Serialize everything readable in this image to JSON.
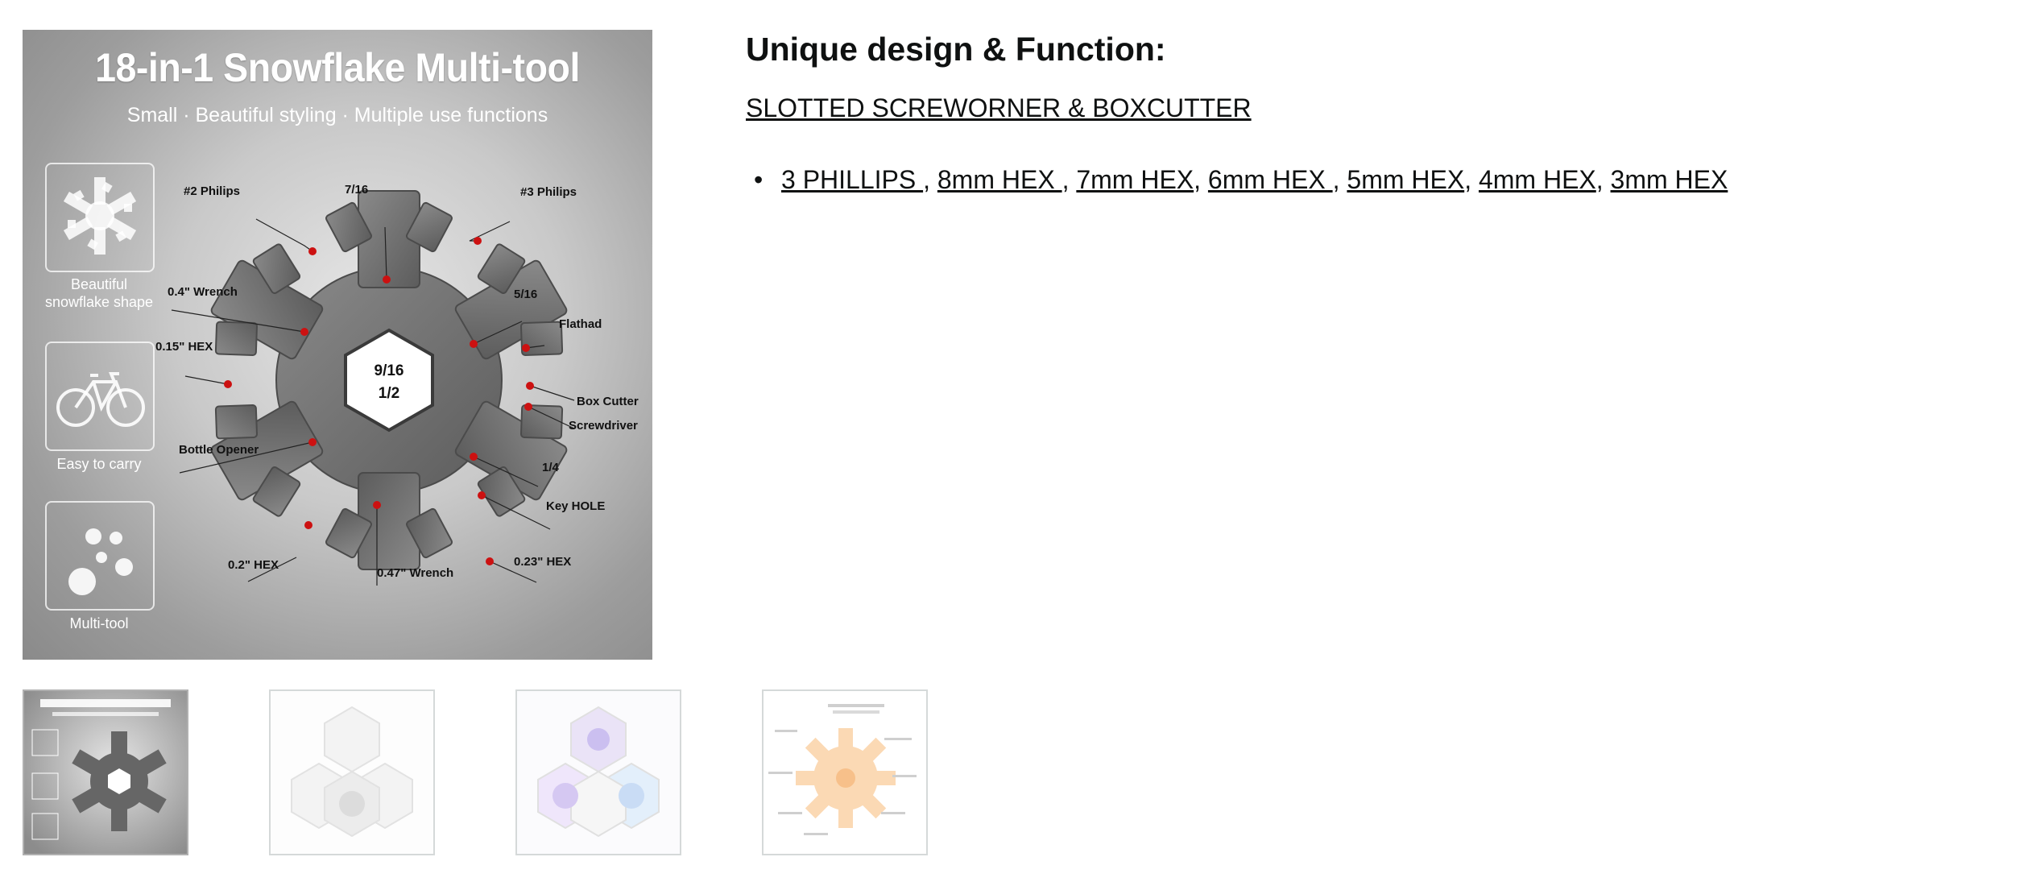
{
  "main_image": {
    "title": "18-in-1 Snowflake Multi-tool",
    "subtitle": "Small · Beautiful styling · Multiple use functions",
    "features": [
      {
        "label_line1": "Beautiful",
        "label_line2": "snowflake shape",
        "icon": "snowflake-icon"
      },
      {
        "label_line1": "Easy to carry",
        "label_line2": "",
        "icon": "bicycle-icon"
      },
      {
        "label_line1": "Multi-tool",
        "label_line2": "",
        "icon": "dots-icon"
      }
    ],
    "center_hex": [
      "9/16",
      "1/2"
    ],
    "callouts": {
      "philips2": "#2 Philips",
      "size716": "7/16",
      "philips3": "#3 Philips",
      "wrench04": "0.4\" Wrench",
      "size516": "5/16",
      "flathad": "Flathad",
      "hex015": "0.15\" HEX",
      "box_cutter": "Box Cutter",
      "screwdriver": "Screwdriver",
      "bottle_opener": "Bottle Opener",
      "size14": "1/4",
      "key_hole": "Key HOLE",
      "hex02": "0.2\" HEX",
      "wrench047": "0.47\" Wrench",
      "hex023": "0.23\" HEX"
    }
  },
  "thumbnails": [
    {
      "name": "thumbnail-1",
      "selected": true
    },
    {
      "name": "thumbnail-2",
      "selected": false
    },
    {
      "name": "thumbnail-3",
      "selected": false
    },
    {
      "name": "thumbnail-4",
      "selected": false
    }
  ],
  "description": {
    "heading": "Unique design & Function:",
    "subheading": "SLOTTED SCREWORNER & BOXCUTTER",
    "bullet_char": "•",
    "items": [
      {
        "text": "3 PHILLIPS ",
        "sep": ", "
      },
      {
        "text": "8mm HEX ",
        "sep": ", "
      },
      {
        "text": "7mm HEX",
        "sep": ", "
      },
      {
        "text": "6mm HEX ",
        "sep": ", "
      },
      {
        "text": "5mm HEX",
        "sep": ", "
      },
      {
        "text": "4mm HEX",
        "sep": ", "
      },
      {
        "text": "3mm HEX",
        "sep": ""
      }
    ]
  },
  "colors": {
    "text": "#0f1111",
    "thumb_border": "#d5d9d9",
    "callout_dot": "#cc1111",
    "tool_metal": "#6d6d6d"
  }
}
